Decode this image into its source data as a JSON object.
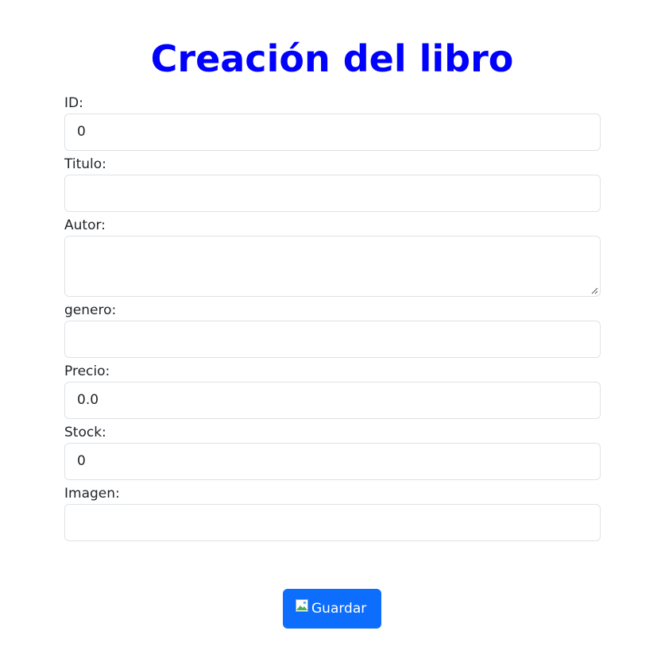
{
  "page": {
    "title": "Creación del libro"
  },
  "form": {
    "fields": [
      {
        "label": "ID:",
        "value": "0"
      },
      {
        "label": "Titulo:",
        "value": ""
      },
      {
        "label": "Autor:",
        "value": ""
      },
      {
        "label": "genero:",
        "value": ""
      },
      {
        "label": "Precio:",
        "value": "0.0"
      },
      {
        "label": "Stock:",
        "value": "0"
      },
      {
        "label": "Imagen:",
        "value": ""
      }
    ],
    "submit": {
      "label": "Guardar",
      "icon": "broken-image-icon"
    }
  },
  "colors": {
    "title": "#0000ff",
    "button": "#0d6efd",
    "input_border": "#dee2e6"
  }
}
